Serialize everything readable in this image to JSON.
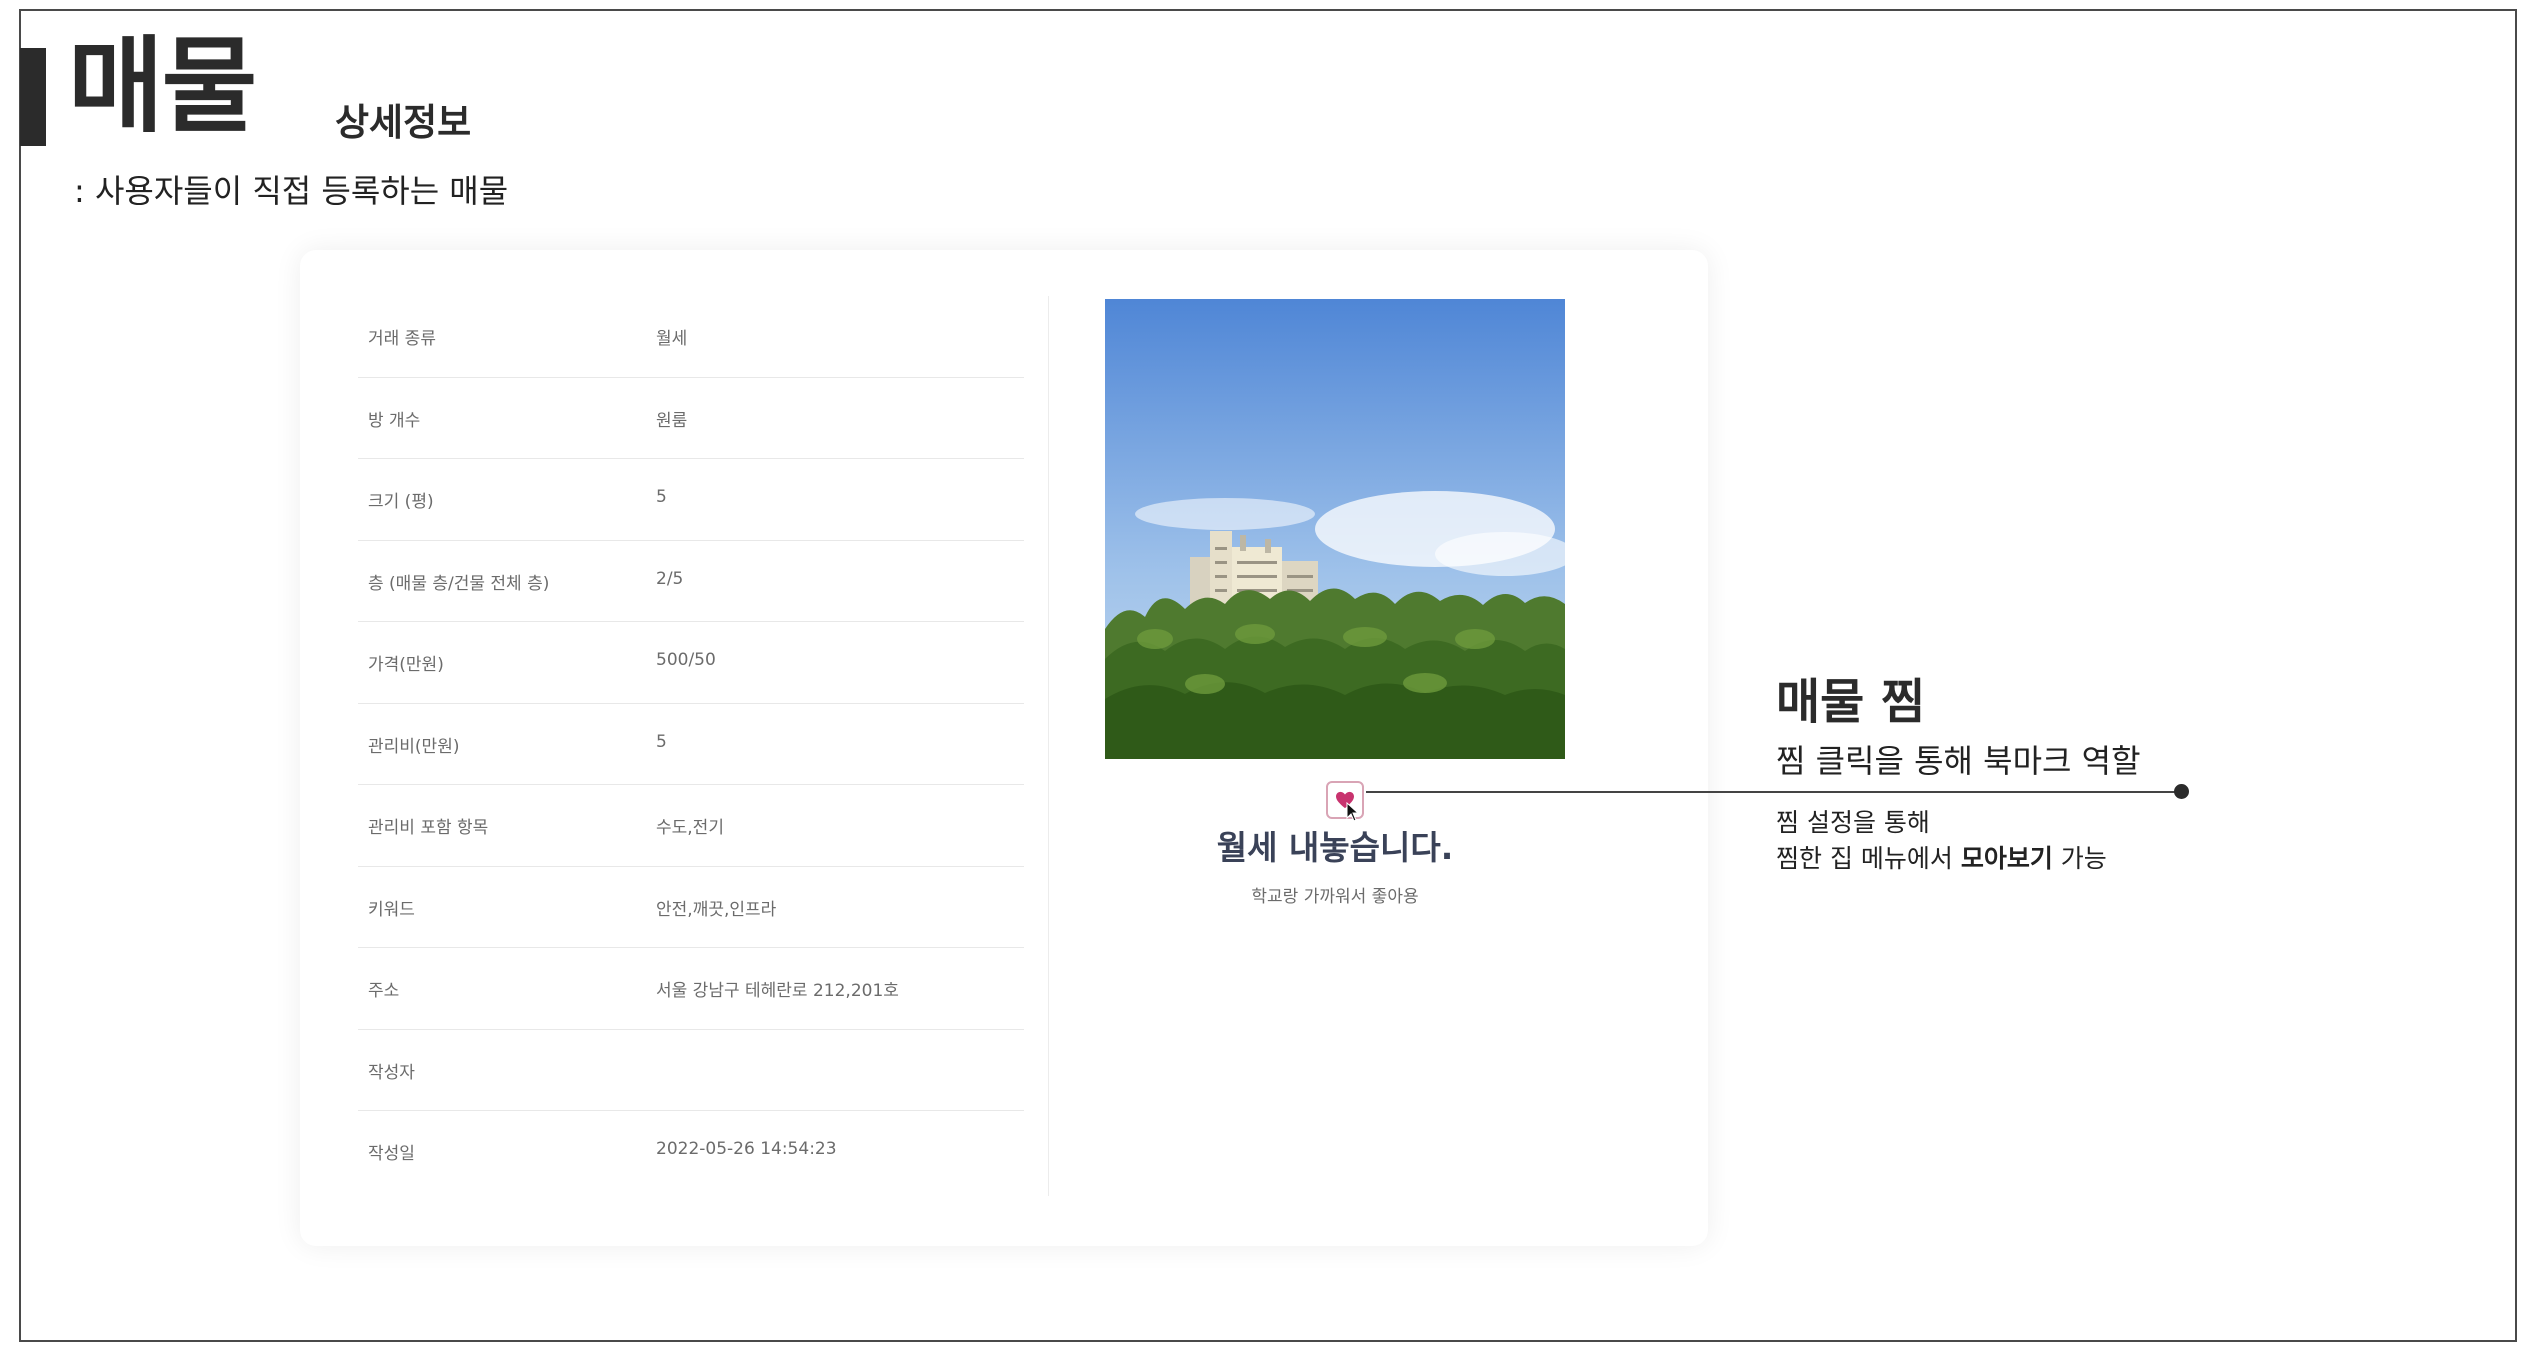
{
  "page": {
    "title": "매물",
    "title_sub": "상세정보",
    "subtitle": ": 사용자들이 직접 등록하는 매물"
  },
  "details": [
    {
      "label": "거래 종류",
      "value": "월세"
    },
    {
      "label": "방 개수",
      "value": "원룸"
    },
    {
      "label": "크기 (평)",
      "value": "5"
    },
    {
      "label": "층 (매물 층/건물 전체 층)",
      "value": "2/5"
    },
    {
      "label": "가격(만원)",
      "value": "500/50"
    },
    {
      "label": "관리비(만원)",
      "value": "5"
    },
    {
      "label": "관리비 포함 항목",
      "value": "수도,전기"
    },
    {
      "label": "키워드",
      "value": "안전,깨끗,인프라"
    },
    {
      "label": "주소",
      "value": "서울 강남구 테헤란로 212,201호"
    },
    {
      "label": "작성자",
      "value": ""
    },
    {
      "label": "작성일",
      "value": "2022-05-26 14:54:23"
    }
  ],
  "listing": {
    "title": "월세 내놓습니다.",
    "description": "학교랑 가까워서 좋아용",
    "bookmark_icon": "heart-icon"
  },
  "callout": {
    "title": "매물 찜",
    "subtitle": "찜 클릭을 통해 북마크 역할",
    "note_line1": "찜 설정을 통해",
    "note_line2_prefix": "찜한 집 메뉴에서 ",
    "note_line2_bold": "모아보기",
    "note_line2_suffix": " 가능"
  },
  "colors": {
    "accent_dark": "#2b2b2b",
    "heart": "#c8336e",
    "listing_title": "#3a4258"
  }
}
